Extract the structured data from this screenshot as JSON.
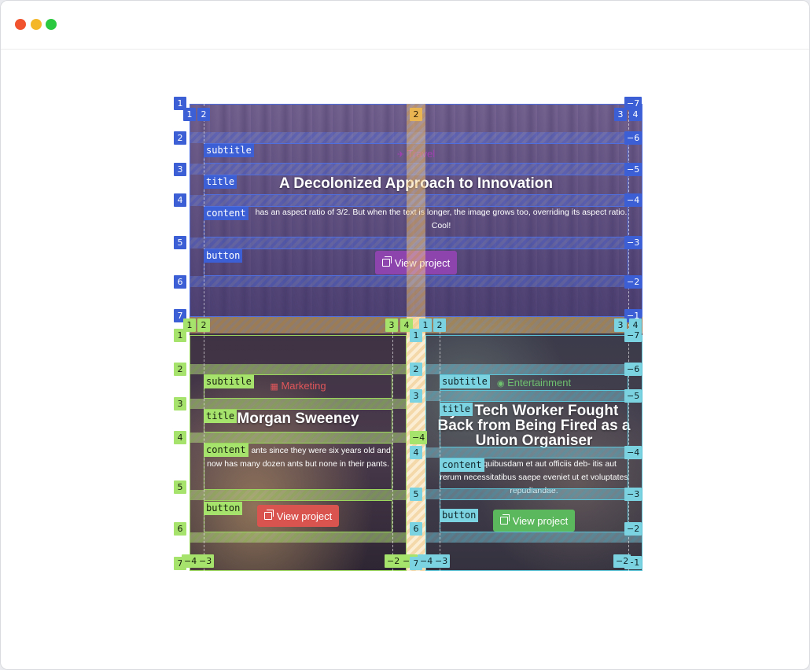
{
  "window": {
    "controls": [
      "close",
      "minimize",
      "maximize"
    ]
  },
  "colors": {
    "blue": "#3c5fd6",
    "green": "#a6e36c",
    "teal": "#7bd3e1",
    "orange": "#e9b452",
    "purple_button": "#8e44ad",
    "red_button": "#d9534f",
    "green_button": "#5cb85c"
  },
  "cards": [
    {
      "subtitle": "Travel",
      "subtitle_icon": "plane-icon",
      "title": "A Decolonized Approach to Innovation",
      "content": "has an aspect ratio of 3/2. But when the text is longer, the image grows too, overriding its aspect ratio. Cool!",
      "button": "View project"
    },
    {
      "subtitle": "Marketing",
      "subtitle_icon": "grid-icon",
      "title": "Morgan Sweeney",
      "content": "as collected ants since they were six years old and now has many dozen ants but none in their pants.",
      "button": "View project"
    },
    {
      "subtitle": "Entertainment",
      "subtitle_icon": "eye-icon",
      "title": "y a Tech Worker Fought Back from Being Fired as a Union Organiser",
      "content": "s autem quibusdam et aut officiis deb- itis aut rerum necessitatibus saepe eveniet ut et voluptates repudiandae.",
      "button": "View project"
    }
  ],
  "area_labels": {
    "subtitle": "subtitle",
    "title": "title",
    "content": "content",
    "button": "button"
  },
  "grid_badges": {
    "main_rows": [
      "1",
      "2",
      "3",
      "4",
      "5",
      "6",
      "7"
    ],
    "main_rows_neg": [
      "−7",
      "−6",
      "−5",
      "−4",
      "−3",
      "−2",
      "−1"
    ],
    "main_cols": [
      "1",
      "2",
      "3",
      "4"
    ],
    "outer_col": "2",
    "card_rows": [
      "1",
      "2",
      "3",
      "4",
      "5",
      "6",
      "7"
    ],
    "card_rows_neg": [
      "−7",
      "−6",
      "−5",
      "−4",
      "−3",
      "−2",
      "−1"
    ],
    "card_cols": [
      "1",
      "2",
      "3",
      "4"
    ],
    "card_cols_neg": [
      "−4",
      "−3",
      "−2",
      "−1"
    ]
  }
}
